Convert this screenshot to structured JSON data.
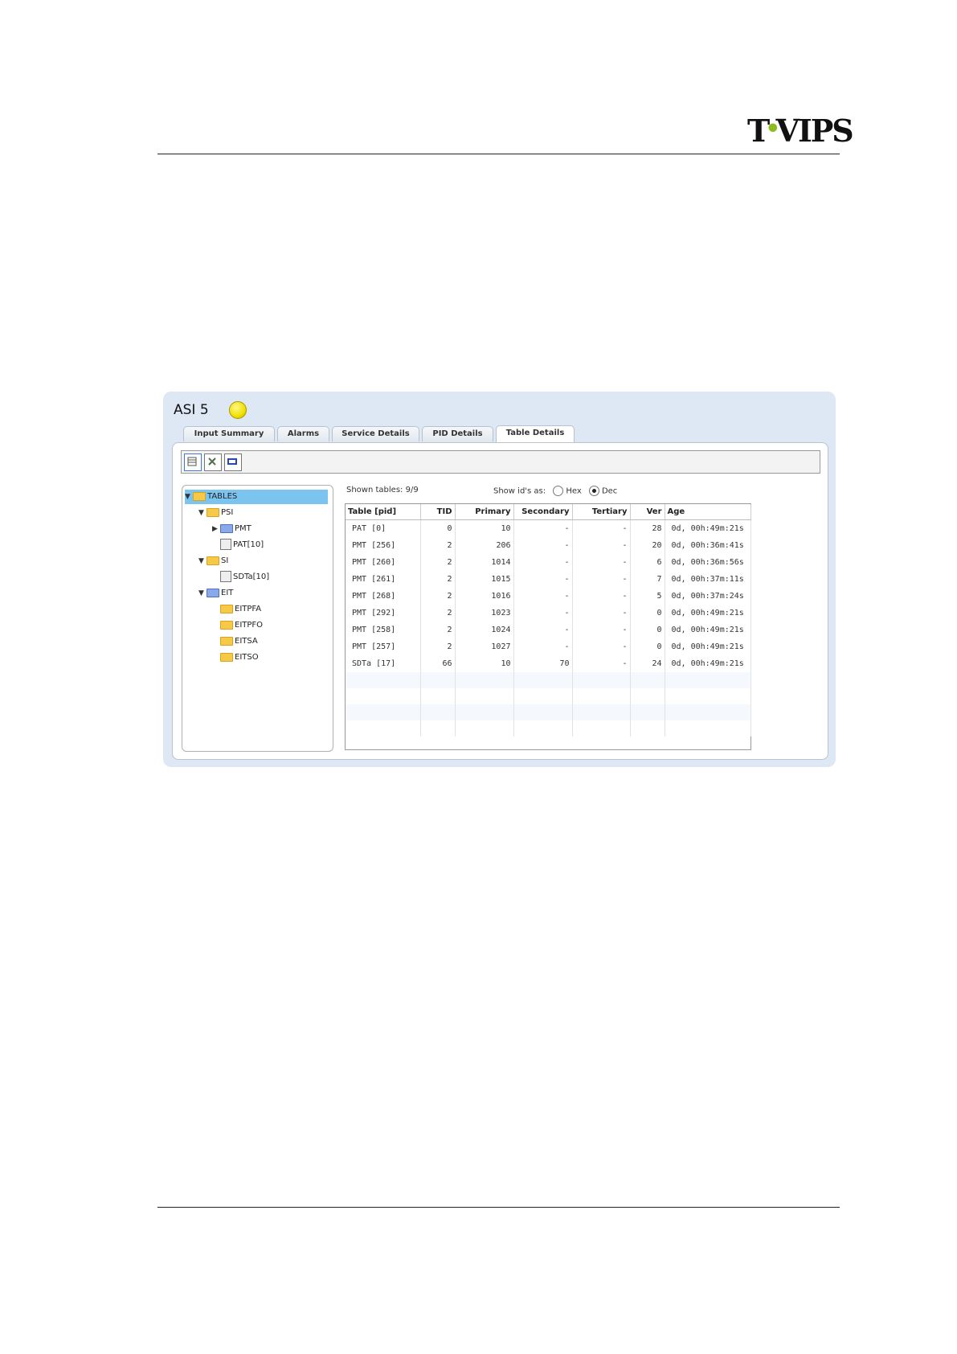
{
  "header": {
    "logo_left": "T",
    "logo_dot": "•",
    "logo_right": "VIPS"
  },
  "panel": {
    "title": "ASI 5",
    "status_color": "#f1e100",
    "tabs": [
      {
        "label": "Input Summary",
        "active": false
      },
      {
        "label": "Alarms",
        "active": false
      },
      {
        "label": "Service Details",
        "active": false
      },
      {
        "label": "PID Details",
        "active": false
      },
      {
        "label": "Table Details",
        "active": true
      }
    ],
    "toolbar": [
      {
        "icon": "list-view-icon"
      },
      {
        "icon": "tools-icon"
      },
      {
        "icon": "si-icon"
      }
    ]
  },
  "tree": {
    "root": "TABLES",
    "psi": "PSI",
    "pmt": "PMT",
    "pat": "PAT[10]",
    "si": "SI",
    "sdta": "SDTa[10]",
    "eit": "EIT",
    "eitpfa": "EITPFA",
    "eitpfo": "EITPFO",
    "eitsa": "EITSA",
    "eitso": "EITSO"
  },
  "info": {
    "shown_tables": "Shown tables: 9/9",
    "show_ids_label": "Show id's as:",
    "hex_label": "Hex",
    "dec_label": "Dec",
    "selected": "Dec"
  },
  "grid": {
    "columns": [
      "Table [pid]",
      "TID",
      "Primary",
      "Secondary",
      "Tertiary",
      "Ver",
      "Age"
    ],
    "rows": [
      [
        "PAT [0]",
        "0",
        "10",
        "-",
        "-",
        "28",
        "0d, 00h:49m:21s"
      ],
      [
        "PMT [256]",
        "2",
        "206",
        "-",
        "-",
        "20",
        "0d, 00h:36m:41s"
      ],
      [
        "PMT [260]",
        "2",
        "1014",
        "-",
        "-",
        "6",
        "0d, 00h:36m:56s"
      ],
      [
        "PMT [261]",
        "2",
        "1015",
        "-",
        "-",
        "7",
        "0d, 00h:37m:11s"
      ],
      [
        "PMT [268]",
        "2",
        "1016",
        "-",
        "-",
        "5",
        "0d, 00h:37m:24s"
      ],
      [
        "PMT [292]",
        "2",
        "1023",
        "-",
        "-",
        "0",
        "0d, 00h:49m:21s"
      ],
      [
        "PMT [258]",
        "2",
        "1024",
        "-",
        "-",
        "0",
        "0d, 00h:49m:21s"
      ],
      [
        "PMT [257]",
        "2",
        "1027",
        "-",
        "-",
        "0",
        "0d, 00h:49m:21s"
      ],
      [
        "SDTa [17]",
        "66",
        "10",
        "70",
        "-",
        "24",
        "0d, 00h:49m:21s"
      ]
    ]
  }
}
